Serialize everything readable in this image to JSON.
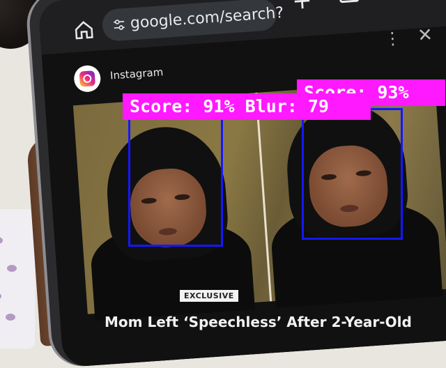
{
  "browser": {
    "url": "google.com/search?"
  },
  "sheet": {
    "source_name": "Instagram"
  },
  "article": {
    "badge": "EXCLUSIVE",
    "headline": "Mom Left ‘Speechless’ After 2-Year-Old"
  },
  "detections": [
    {
      "label": "Score: 91% Blur: 79"
    },
    {
      "label": "Score: 93%"
    }
  ],
  "colors": {
    "bbox": "#1418ff",
    "label_bg": "#ff19ff",
    "instagram": "#ee2a7b"
  }
}
